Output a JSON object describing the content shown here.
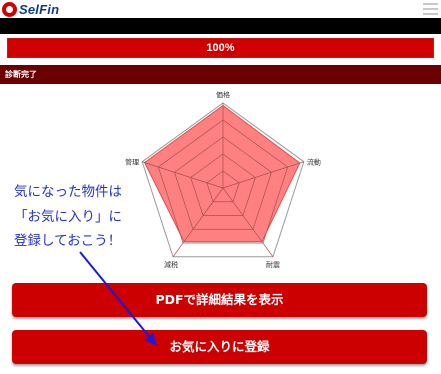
{
  "header": {
    "logo_text": "SelFin",
    "menu_icon": "hamburger-menu-icon"
  },
  "progress": {
    "label": "100%",
    "value": 1.0
  },
  "status": {
    "label": "診断完了"
  },
  "radar": {
    "axes": [
      "価格",
      "流動",
      "耐震",
      "減税",
      "管理"
    ],
    "values": [
      0.97,
      0.95,
      0.78,
      0.78,
      0.97
    ],
    "max": 1,
    "levels": 5
  },
  "annotation": {
    "lines": [
      "気になった物件は",
      "「お気に入り」に",
      "登録しておこう！"
    ],
    "color": "#2233cc"
  },
  "buttons": {
    "pdf_label": "PDFで詳細結果を表示",
    "favorite_label": "お気に入りに登録"
  },
  "colors": {
    "accent": "#cc0000",
    "status_bar": "#6b0000",
    "radar_fill": "#ff8080",
    "radar_stroke": "#e05050"
  }
}
